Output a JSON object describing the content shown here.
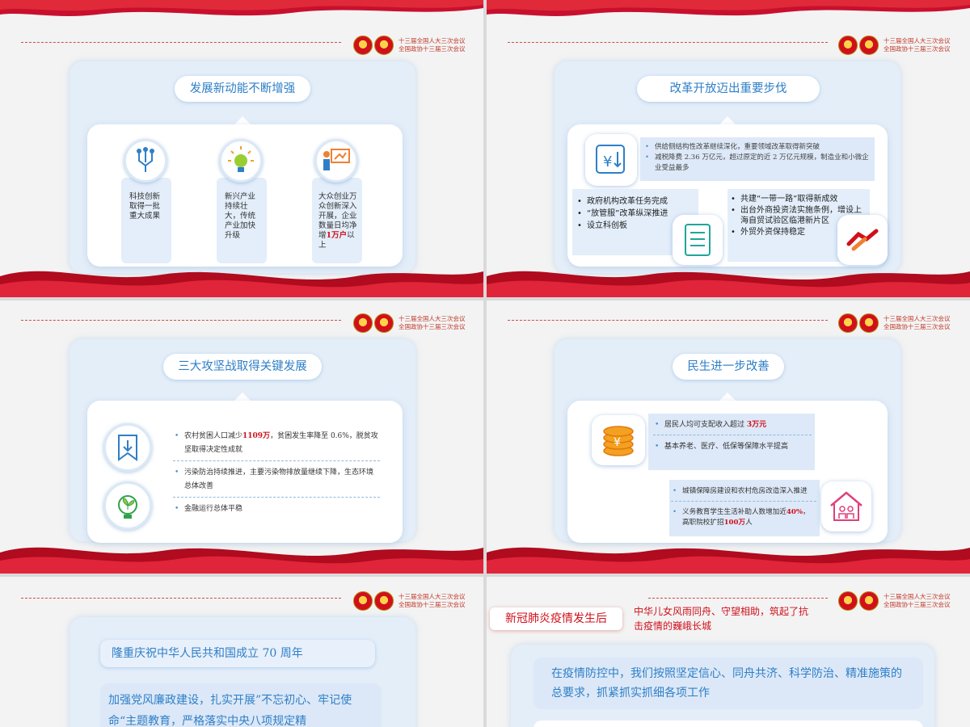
{
  "header": {
    "line1": "十三届全国人大三次会议",
    "line2": "全国政协十三届三次会议"
  },
  "slide1": {
    "title": "发展新动能不断增强",
    "cols": [
      {
        "icon": "circuit-icon",
        "text": "科技创新取得一批重大成果"
      },
      {
        "icon": "lightbulb-icon",
        "text": "新兴产业持续壮大，传统产业加快升级"
      },
      {
        "icon": "presentation-icon",
        "text_pre": "大众创业万众创新深入开展，企业数量日均净增",
        "highlight": "1万户",
        "text_post": "以上"
      }
    ]
  },
  "slide2": {
    "title": "改革开放迈出重要步伐",
    "top_bullets": [
      "供给侧结构性改革继续深化，重要领域改革取得新突破",
      "减税降费 2.36 万亿元，超过原定的近 2 万亿元规模，制造业和小微企业受益最多"
    ],
    "left_bullets": [
      "政府机构改革任务完成",
      "“放管服”改革纵深推进",
      "设立科创板"
    ],
    "right_bullets": [
      "共建“一带一路”取得新成效",
      "出台外商投资法实施条例，增设上海自贸试验区临港新片区",
      "外贸外资保持稳定"
    ]
  },
  "slide3": {
    "title": "三大攻坚战取得关键发展",
    "bullets": [
      {
        "pre": "农村贫困人口减少",
        "highlight": "1109万",
        "post": "，贫困发生率降至 0.6%，脱贫攻坚取得决定性成就"
      },
      {
        "pre": "污染防治持续推进，主要污染物排放量继续下降，生态环境总体改善",
        "highlight": "",
        "post": ""
      },
      {
        "pre": "金融运行总体平稳",
        "highlight": "",
        "post": ""
      }
    ]
  },
  "slide4": {
    "title": "民生进一步改善",
    "top_bullets": [
      {
        "pre": "居民人均可支配收入超过",
        "highlight": "3万元",
        "post": ""
      },
      {
        "pre": "基本养老、医疗、低保等保障水平提高",
        "highlight": "",
        "post": ""
      }
    ],
    "bottom_bullets": [
      {
        "pre": "城镇保障房建设和农村危房改造深入推进",
        "highlight": "",
        "post": ""
      },
      {
        "pre": "义务教育学生生活补助人数增加近",
        "highlight": "40%",
        "post": "，高职院校扩招",
        "highlight2": "100万",
        "post2": "人"
      }
    ]
  },
  "slide5": {
    "title": "隆重庆祝中华人民共和国成立 70 周年",
    "body": "加强党风廉政建设，扎实开展”不忘初心、牢记使命“主题教育，严格落实中央八项规定精"
  },
  "slide6": {
    "tag": "新冠肺炎疫情发生后",
    "red_text": "中华儿女风雨同舟、守望相助，筑起了抗击疫情的巍峨长城",
    "body": "在疫情防控中，我们按照坚定信心、同舟共济、科学防治、精准施策的总要求，抓紧抓实抓细各项工作"
  },
  "colors": {
    "accent": "#2e7fc7",
    "highlight": "#d0101b",
    "card": "#e4eef9"
  }
}
